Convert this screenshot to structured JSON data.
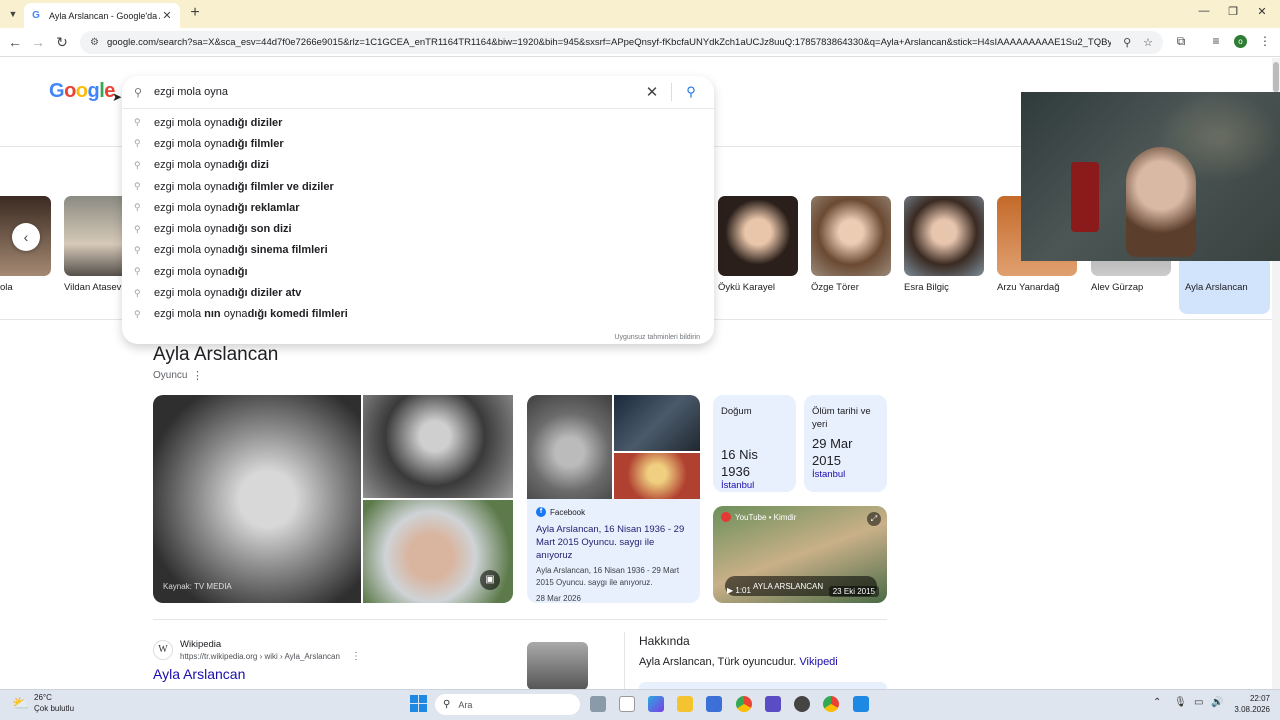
{
  "browser": {
    "tab_title": "Ayla Arslancan - Google'da Ara",
    "favicon": "G",
    "url": "google.com/search?sa=X&sca_esv=44d7f0e7266e9015&rlz=1C1GCEA_enTR1164TR1164&biw=1920&bih=945&sxsrf=APpeQnsyf-fKbcfaUNYdkZch1aUCJz8uuQ:1785783864330&q=Ayla+Arslancan&stick=H4sIAAAAAAAAAE1Su2_TQByuE4jS4j...",
    "profile_initial": "o"
  },
  "google": {
    "logo": [
      "G",
      "o",
      "o",
      "g",
      "l",
      "e"
    ]
  },
  "search": {
    "query": "ezgi mola oyna",
    "report_text": "Uygunsuz tahminleri bildirin",
    "suggestions": [
      {
        "prefix": "ezgi mola oyna",
        "bold": "dığı diziler"
      },
      {
        "prefix": "ezgi mola oyna",
        "bold": "dığı filmler"
      },
      {
        "prefix": "ezgi mola oyna",
        "bold": "dığı dizi"
      },
      {
        "prefix": "ezgi mola oyna",
        "bold": "dığı filmler ve diziler"
      },
      {
        "prefix": "ezgi mola oyna",
        "bold": "dığı reklamlar"
      },
      {
        "prefix": "ezgi mola oyna",
        "bold": "dığı son dizi"
      },
      {
        "prefix": "ezgi mola oyna",
        "bold": "dığı sinema filmleri"
      },
      {
        "prefix": "ezgi mola oyna",
        "bold": "dığı"
      },
      {
        "prefix": "ezgi mola oyna",
        "bold": "dığı diziler atv"
      },
      {
        "prefix": "ezgi mola ",
        "bold": "nın",
        "prefix2": " oyna",
        "bold2": "dığı komedi filmleri"
      }
    ]
  },
  "carousel": {
    "people": [
      "ola",
      "Vildan Atasev",
      "Öykü Karayel",
      "Özge Törer",
      "Esra Bilgiç",
      "Arzu Yanardağ",
      "Alev Gürzap",
      "Ayla Arslancan"
    ]
  },
  "entity": {
    "title": "Ayla Arslancan",
    "subtitle": "Oyuncu",
    "photo_credit": "Kaynak: TV MEDIA",
    "facts": [
      {
        "label": "Doğum",
        "value": "16 Nis 1936",
        "place": "İstanbul"
      },
      {
        "label": "Ölüm tarihi ve yeri",
        "value": "29 Mar 2015",
        "place": "İstanbul"
      }
    ],
    "facebook": {
      "source": "Facebook",
      "title": "Ayla Arslancan, 16 Nisan 1936 - 29 Mart 2015 Oyuncu. saygı ile anıyoruz",
      "snippet": "Ayla Arslancan, 16 Nisan 1936 - 29 Mart 2015 Oyuncu. saygı ile anıyoruz.",
      "date": "28 Mar 2026"
    },
    "youtube": {
      "source": "YouTube • Kimdir",
      "caption": "AYLA ARSLANCAN",
      "duration": "1:01",
      "date": "23 Eki 2015"
    }
  },
  "result": {
    "site": "Wikipedia",
    "url": "https://tr.wikipedia.org › wiki › Ayla_Arslancan",
    "title": "Ayla Arslancan",
    "favicon": "W"
  },
  "about": {
    "heading": "Hakkında",
    "text": "Ayla Arslancan, Türk oyuncudur. ",
    "link": "Vikipedi"
  },
  "taskbar": {
    "temp": "26°C",
    "weather": "Çok bulutlu",
    "search_placeholder": "Ara",
    "time": "22:07",
    "date": "3.08.2026"
  }
}
